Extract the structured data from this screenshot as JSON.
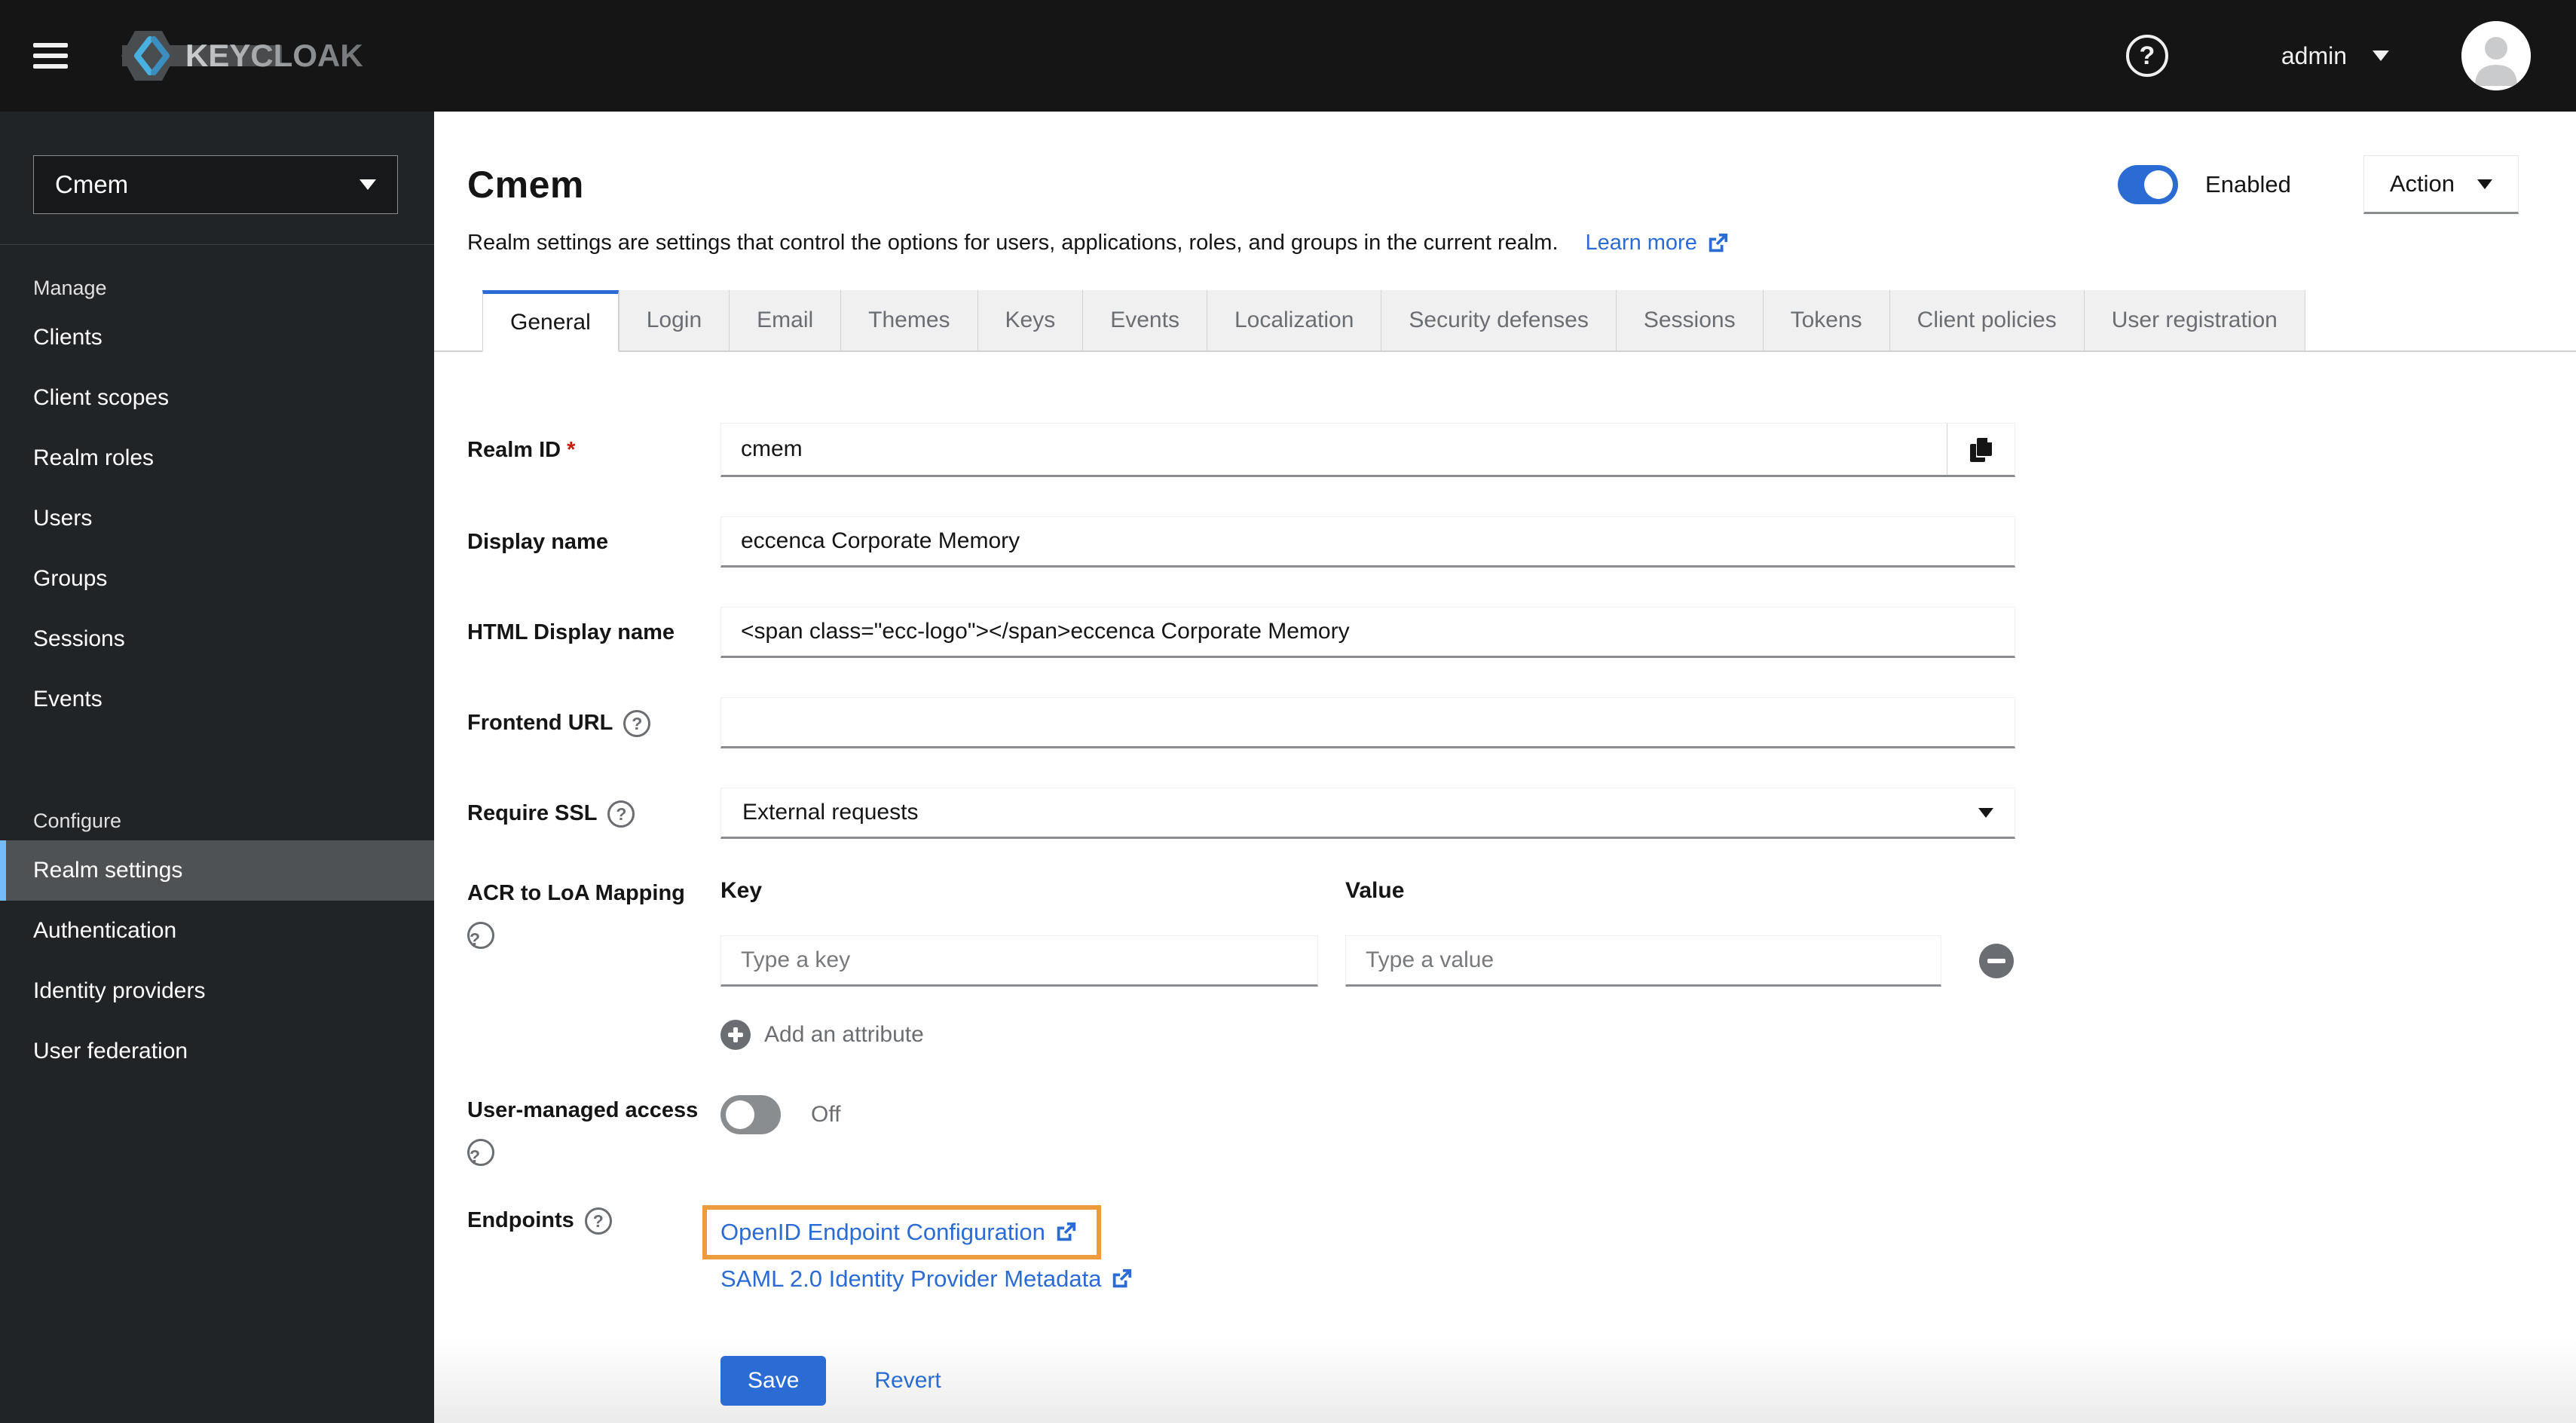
{
  "masthead": {
    "brand": "KEYCLOAK",
    "user": "admin"
  },
  "icons": {
    "help": "?"
  },
  "sidebar": {
    "realm": "Cmem",
    "sections": [
      {
        "label": "Manage",
        "items": [
          "Clients",
          "Client scopes",
          "Realm roles",
          "Users",
          "Groups",
          "Sessions",
          "Events"
        ]
      },
      {
        "label": "Configure",
        "items": [
          "Realm settings",
          "Authentication",
          "Identity providers",
          "User federation"
        ],
        "active_item": "Realm settings"
      }
    ]
  },
  "header": {
    "title": "Cmem",
    "description": "Realm settings are settings that control the options for users, applications, roles, and groups in the current realm.",
    "learn_more": "Learn more",
    "enabled_label": "Enabled",
    "enabled_state": "on",
    "action_label": "Action"
  },
  "tabs": [
    "General",
    "Login",
    "Email",
    "Themes",
    "Keys",
    "Events",
    "Localization",
    "Security defenses",
    "Sessions",
    "Tokens",
    "Client policies",
    "User registration"
  ],
  "active_tab": "General",
  "form": {
    "required_marker": "*",
    "realm_id": {
      "label": "Realm ID",
      "value": "cmem"
    },
    "display_name": {
      "label": "Display name",
      "value": "eccenca Corporate Memory"
    },
    "html_display_name": {
      "label": "HTML Display name",
      "value": "<span class=\"ecc-logo\"></span>eccenca Corporate Memory"
    },
    "frontend_url": {
      "label": "Frontend URL",
      "value": ""
    },
    "require_ssl": {
      "label": "Require SSL",
      "value": "External requests"
    },
    "acr_loa": {
      "label": "ACR to LoA Mapping",
      "key_header": "Key",
      "value_header": "Value",
      "key_placeholder": "Type a key",
      "value_placeholder": "Type a value",
      "add_label": "Add an attribute"
    },
    "user_managed_access": {
      "label": "User-managed access",
      "state": "Off"
    },
    "endpoints": {
      "label": "Endpoints",
      "links": [
        "OpenID Endpoint Configuration",
        "SAML 2.0 Identity Provider Metadata"
      ]
    },
    "actions": {
      "save": "Save",
      "revert": "Revert"
    }
  },
  "colors": {
    "primary_blue": "#2b6cd4",
    "highlight_box_orange": "#ec9b3d",
    "sidebar_bg": "#212427",
    "masthead_bg": "#151515",
    "active_nav_accent": "#73bcf7"
  }
}
